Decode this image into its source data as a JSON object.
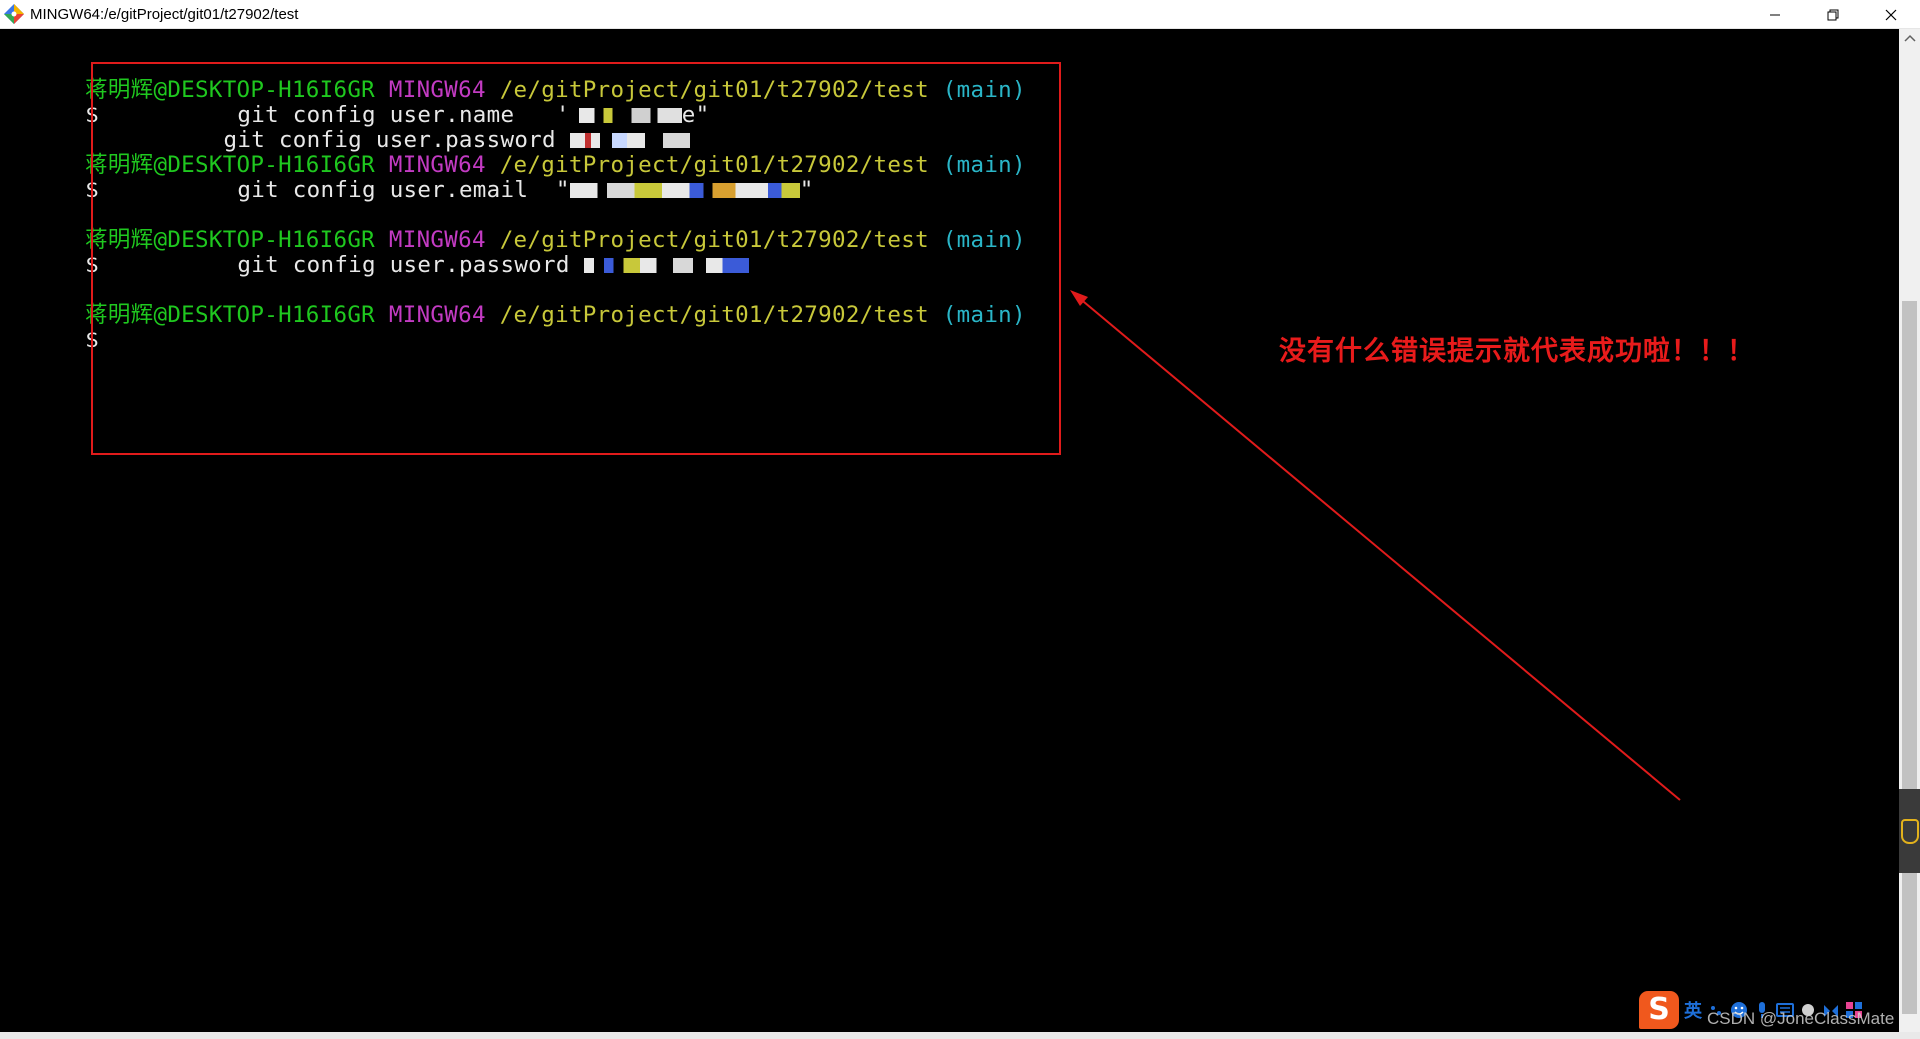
{
  "window": {
    "title": "MINGW64:/e/gitProject/git01/t27902/test",
    "icon": "git-bash-icon",
    "controls": [
      "minimize-icon",
      "maximize-icon",
      "close-icon"
    ]
  },
  "terminal": {
    "prompt_user": "蒋明辉",
    "prompt_host": "@DESKTOP-H16I6GR",
    "prompt_system": "MINGW64",
    "prompt_path": "/e/gitProject/git01/t27902/test",
    "prompt_branch": "(main)",
    "prompt_symbol": "$",
    "commands": {
      "user_name": "git config user.name",
      "user_name_value_open": " '",
      "user_name_value_close": "e\"",
      "user_password_1": "git config user.password",
      "user_email": "git config user.email",
      "user_email_value_open": "\"",
      "user_email_value_close": "\"",
      "user_password_2": "git config user.password"
    }
  },
  "annotation": {
    "text": "没有什么错误提示就代表成功啦！！！",
    "color": "#e81b1b"
  },
  "ime_toolbar": {
    "logo": "S",
    "language": "英",
    "icons": [
      "punctuation-icon",
      "emoji-icon",
      "microphone-icon",
      "keyboard-icon",
      "skin-icon",
      "menu-icon"
    ]
  },
  "watermark": "CSDN @JoneClassMate",
  "colors": {
    "user": "#1fc81f",
    "system": "#c33bc3",
    "path": "#c8c83a",
    "branch": "#2ab6c8",
    "annotation": "#e01b1b"
  }
}
